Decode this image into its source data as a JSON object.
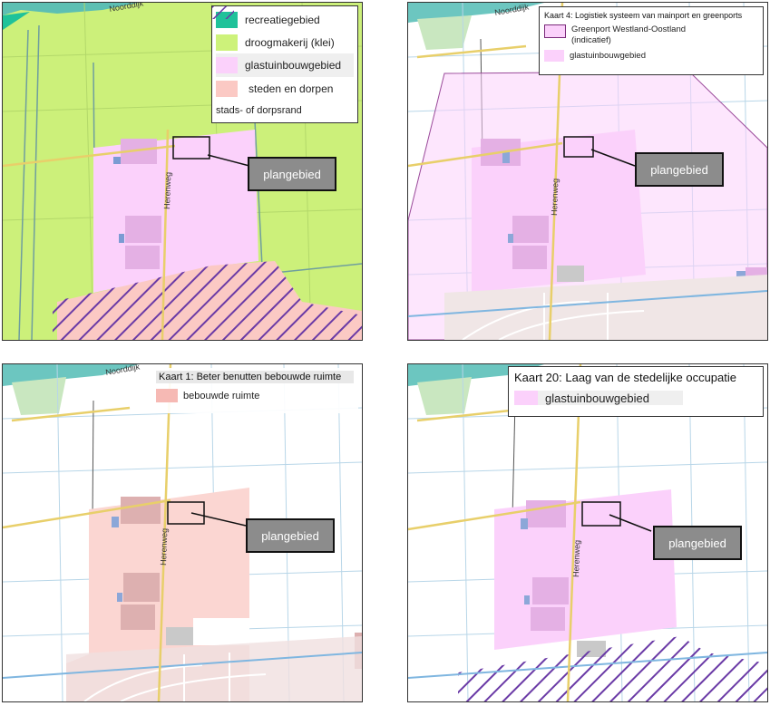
{
  "colors": {
    "recreatiegebied": "#1fc29a",
    "droogmakerij": "#cdf27a",
    "glastuinbouwgebied": "#fbd1fb",
    "steden_en_dorpen": "#fbc9c4",
    "stadsrand": "#6a3aa6",
    "bebouwde_ruimte": "#f6b9b4"
  },
  "roads": {
    "herenweg": "Herenweg",
    "noorddijk": "Noorddijk"
  },
  "callout": "plangebied",
  "panels": [
    {
      "legend": {
        "items": [
          {
            "label": "recreatiegebied"
          },
          {
            "label": "droogmakerij (klei)"
          },
          {
            "label": "glastuinbouwgebied"
          },
          {
            "label": "steden en dorpen"
          },
          {
            "label": "stads- of dorpsrand"
          }
        ]
      }
    },
    {
      "legend": {
        "title": "Kaart 4: Logistiek systeem van mainport en greenports",
        "items": [
          {
            "label": "Greenport Westland-Oostland (indicatief)"
          },
          {
            "label": "glastuinbouwgebied"
          }
        ]
      }
    },
    {
      "legend": {
        "title": "Kaart 1: Beter benutten bebouwde ruimte",
        "items": [
          {
            "label": "bebouwde ruimte"
          }
        ]
      }
    },
    {
      "legend": {
        "title": "Kaart 20: Laag van de stedelijke occupatie",
        "items": [
          {
            "label": "glastuinbouwgebied"
          }
        ]
      }
    }
  ]
}
